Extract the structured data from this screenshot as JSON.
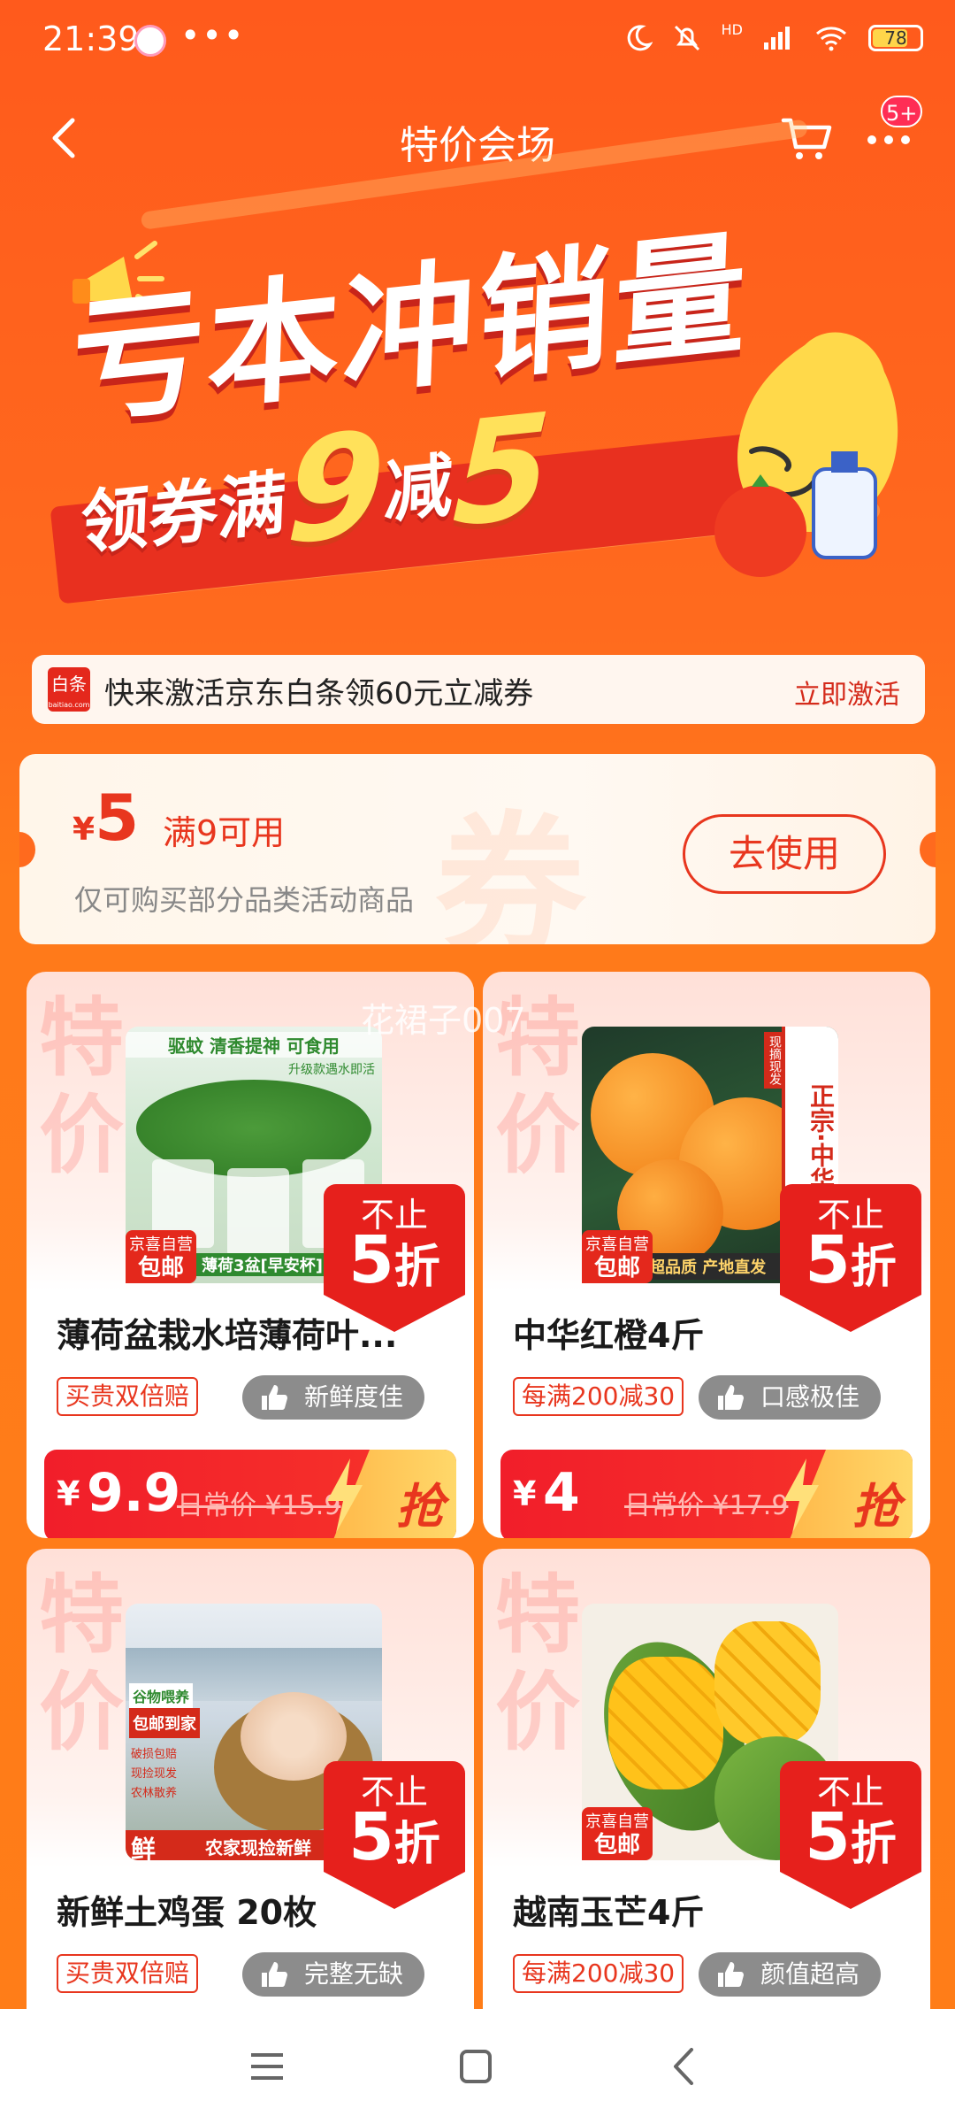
{
  "status_bar": {
    "time": "21:39",
    "dots": "•••",
    "battery": "78",
    "network": "HD"
  },
  "header": {
    "title": "特价会场",
    "badge": "5+"
  },
  "banner": {
    "headline": "亏本冲销量",
    "sub_prefix": "领券满",
    "sub_num1": "9",
    "sub_mid": "减",
    "sub_num2": "5"
  },
  "baitiao": {
    "logo": "白条",
    "logo_sub": "baitiao.com",
    "text": "快来激活京东白条领60元立减券",
    "cta": "立即激活"
  },
  "coupon": {
    "currency": "¥",
    "amount": "5",
    "condition": "满9可用",
    "description": "仅可购买部分品类活动商品",
    "button": "去使用",
    "watermark": "券"
  },
  "watermark": "花裙子007",
  "products": [
    {
      "tejia": "特价",
      "name": "薄荷盆栽水培薄荷叶...",
      "img_text_top": "驱蚊  清香提神  可食用",
      "img_text_sub": "升级款遇水即活",
      "img_text_bottom": "薄荷3盆[早安杯]",
      "self_tag1": "京喜自营",
      "self_tag2": "包邮",
      "disc_line1": "不止",
      "disc_num": "5",
      "disc_unit": "折",
      "tag_left": "买贵双倍赔",
      "tag_right": "新鲜度佳",
      "currency": "¥",
      "price": "9.9",
      "orig_price": "日常价 ¥15.9",
      "grab": "抢"
    },
    {
      "tejia": "特价",
      "name": "中华红橙4斤",
      "img_text_side": "正宗·中华",
      "img_text_side2": "现摘现发",
      "img_text_bottom": "超品质   产地直发",
      "self_tag1": "京喜自营",
      "self_tag2": "包邮",
      "disc_line1": "不止",
      "disc_num": "5",
      "disc_unit": "折",
      "tag_left": "每满200减30",
      "tag_right": "口感极佳",
      "currency": "¥",
      "price": "4",
      "orig_price": "日常价 ¥17.9",
      "grab": "抢"
    },
    {
      "tejia": "特价",
      "name": "新鲜土鸡蛋 20枚",
      "img_text_top": "谷物喂养",
      "img_text_red": "包邮到家",
      "img_list": [
        "破损包赔",
        "现捡现发",
        "农林散养"
      ],
      "img_text_bottom": "农家现捡新鲜",
      "img_fresh": "鲜",
      "disc_line1": "不止",
      "disc_num": "5",
      "disc_unit": "折",
      "tag_left": "买贵双倍赔",
      "tag_right": "完整无缺"
    },
    {
      "tejia": "特价",
      "name": "越南玉芒4斤",
      "self_tag1": "京喜自营",
      "self_tag2": "包邮",
      "disc_line1": "不止",
      "disc_num": "5",
      "disc_unit": "折",
      "tag_left": "每满200减30",
      "tag_right": "颜值超高"
    }
  ],
  "colors": {
    "brand": "#ff5a1c",
    "accent_red": "#e6201c",
    "price_bar": "#f11e2a",
    "grab_gold": "#ffd86a"
  },
  "icons": [
    "back-arrow-icon",
    "cart-icon",
    "more-icon",
    "megaphone-icon",
    "thumb-up-icon",
    "lightning-icon",
    "menu-icon",
    "home-square-icon",
    "nav-back-icon"
  ]
}
